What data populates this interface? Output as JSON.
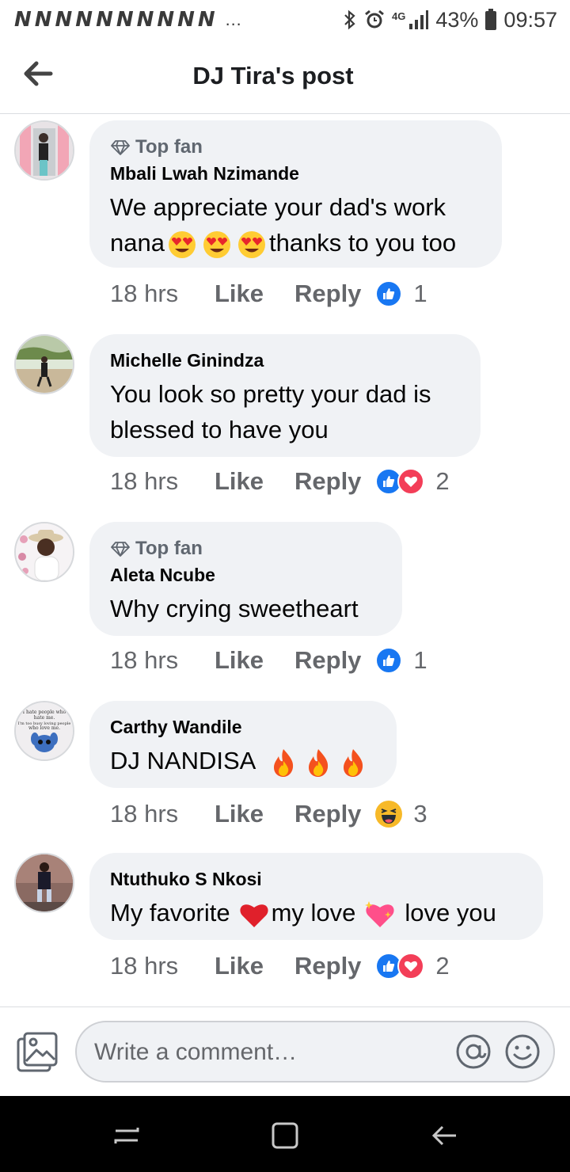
{
  "status_bar": {
    "notification_icons": [
      "n-icon",
      "n-icon",
      "n-icon",
      "n-icon",
      "n-icon",
      "n-icon",
      "n-icon",
      "n-icon",
      "n-icon",
      "n-icon"
    ],
    "more_indicator": "…",
    "network": "4G",
    "battery": "43%",
    "time": "09:57"
  },
  "header": {
    "title": "DJ Tira's post",
    "back_icon": "arrow-left-icon"
  },
  "comments": [
    {
      "top_fan": true,
      "top_fan_label": "Top fan",
      "author": "Mbali Lwah Nzimande",
      "text_line1": "We appreciate your dad's work",
      "text_line2_before": "nana",
      "text_line2_after": "thanks to you too",
      "time": "18 hrs",
      "like_label": "Like",
      "reply_label": "Reply",
      "reactions": [
        "like"
      ],
      "reaction_count": "1"
    },
    {
      "top_fan": false,
      "author": "Michelle Ginindza",
      "text": "You look so pretty your dad is blessed to have you",
      "time": "18 hrs",
      "like_label": "Like",
      "reply_label": "Reply",
      "reactions": [
        "like",
        "love"
      ],
      "reaction_count": "2"
    },
    {
      "top_fan": true,
      "top_fan_label": "Top fan",
      "author": "Aleta Ncube",
      "text": "Why crying sweetheart",
      "time": "18 hrs",
      "like_label": "Like",
      "reply_label": "Reply",
      "reactions": [
        "like"
      ],
      "reaction_count": "1"
    },
    {
      "top_fan": false,
      "author": "Carthy Wandile",
      "text": "DJ NANDISA",
      "time": "18 hrs",
      "like_label": "Like",
      "reply_label": "Reply",
      "reactions": [
        "haha"
      ],
      "reaction_count": "3"
    },
    {
      "top_fan": false,
      "author": "Ntuthuko S Nkosi",
      "text_part1": "My favorite",
      "text_part2": "my love",
      "text_part3": "love you",
      "time": "18 hrs",
      "like_label": "Like",
      "reply_label": "Reply",
      "reactions": [
        "like",
        "love"
      ],
      "reaction_count": "2"
    }
  ],
  "avatar4_text": [
    "I hate people who",
    "hate me.",
    "I'm too busy loving people",
    "who love me."
  ],
  "composer": {
    "placeholder": "Write a comment…"
  },
  "colors": {
    "like_blue": "#1877f2",
    "love_red": "#f33e58",
    "bubble_gray": "#f0f2f5",
    "meta_gray": "#65676b"
  }
}
